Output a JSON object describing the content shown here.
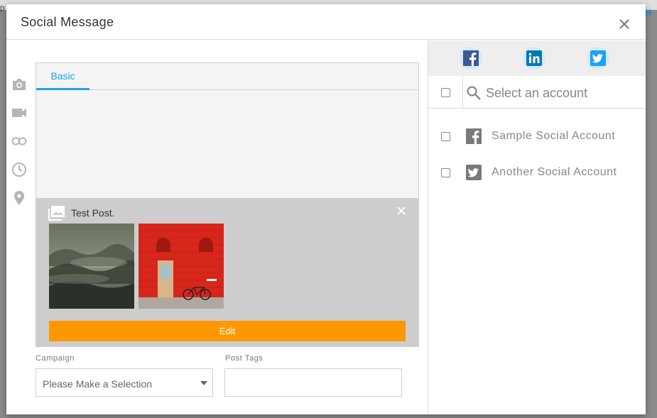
{
  "backdrop": {
    "left_text": "p",
    "right_text": "H"
  },
  "modal": {
    "title": "Social Message"
  },
  "side_tools": [
    "camera-icon",
    "video-icon",
    "link-icon",
    "clock-icon",
    "location-pin-icon"
  ],
  "editor": {
    "tabs": [
      {
        "label": "Basic",
        "active": true
      }
    ],
    "post": {
      "text": "Test Post.",
      "images": [
        "forest-image",
        "red-door-image"
      ],
      "edit_label": "Edit"
    }
  },
  "fields": {
    "campaign": {
      "label": "Campaign",
      "value": "Please Make a Selection"
    },
    "post_tags": {
      "label": "Post Tags",
      "value": ""
    }
  },
  "networks": [
    {
      "name": "facebook-icon"
    },
    {
      "name": "linkedin-icon"
    },
    {
      "name": "twitter-icon"
    }
  ],
  "account_search": {
    "placeholder": "Select an account"
  },
  "accounts": [
    {
      "name": "Sample Social Account",
      "network": "facebook"
    },
    {
      "name": "Another Social Account",
      "network": "twitter"
    }
  ],
  "colors": {
    "accent": "#1aa3e8",
    "edit_button": "#ff9800",
    "facebook": "#3b5998",
    "linkedin": "#0077b5",
    "twitter": "#1da1f2"
  }
}
